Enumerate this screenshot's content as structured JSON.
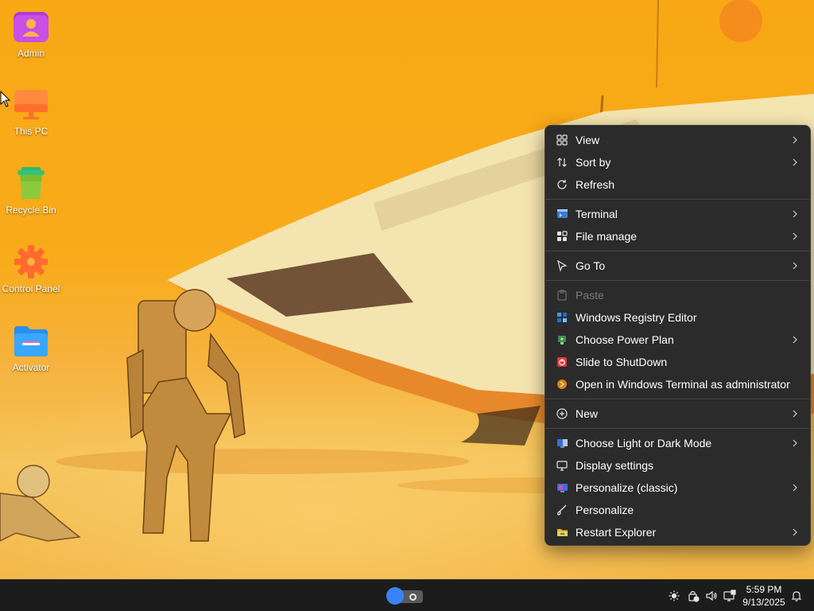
{
  "desktop": {
    "icons": [
      {
        "label": "Admin",
        "icon": "user-folder-icon"
      },
      {
        "label": "This PC",
        "icon": "monitor-icon"
      },
      {
        "label": "Recycle Bin",
        "icon": "recycle-bin-icon"
      },
      {
        "label": "Control Panel",
        "icon": "gear-icon"
      },
      {
        "label": "Activator",
        "icon": "folder-icon"
      }
    ]
  },
  "menu": {
    "sections": [
      [
        {
          "label": "View",
          "icon": "grid-icon",
          "submenu": true
        },
        {
          "label": "Sort by",
          "icon": "sort-icon",
          "submenu": true
        },
        {
          "label": "Refresh",
          "icon": "refresh-icon",
          "submenu": false
        }
      ],
      [
        {
          "label": "Terminal",
          "icon": "terminal-icon",
          "submenu": true
        },
        {
          "label": "File manage",
          "icon": "file-manage-icon",
          "submenu": true
        }
      ],
      [
        {
          "label": "Go To",
          "icon": "pointer-icon",
          "submenu": true
        }
      ],
      [
        {
          "label": "Paste",
          "icon": "paste-icon",
          "submenu": false,
          "disabled": true
        },
        {
          "label": "Windows Registry Editor",
          "icon": "registry-icon",
          "submenu": false
        },
        {
          "label": "Choose Power Plan",
          "icon": "power-plan-icon",
          "submenu": true
        },
        {
          "label": "Slide to ShutDown",
          "icon": "shutdown-icon",
          "submenu": false
        },
        {
          "label": "Open in Windows Terminal as administrator",
          "icon": "admin-terminal-icon",
          "submenu": false
        }
      ],
      [
        {
          "label": "New",
          "icon": "plus-circle-icon",
          "submenu": true
        }
      ],
      [
        {
          "label": "Choose Light or Dark Mode",
          "icon": "theme-icon",
          "submenu": true
        },
        {
          "label": "Display settings",
          "icon": "display-icon",
          "submenu": false
        },
        {
          "label": "Personalize (classic)",
          "icon": "personalize-classic-icon",
          "submenu": true
        },
        {
          "label": "Personalize",
          "icon": "brush-icon",
          "submenu": false
        },
        {
          "label": "Restart Explorer",
          "icon": "explorer-folder-icon",
          "submenu": true
        }
      ]
    ]
  },
  "taskbar": {
    "time": "5:59 PM",
    "date": "9/13/2025",
    "tray_icons": [
      "brightness-icon",
      "security-icon",
      "volume-icon",
      "network-icon",
      "notification-bell-icon"
    ]
  },
  "colors": {
    "menu_bg": "#2b2b2b",
    "taskbar_bg": "#1c1c1c",
    "wallpaper_accent": "#f7a814",
    "toggle_accent": "#3b82f6"
  }
}
